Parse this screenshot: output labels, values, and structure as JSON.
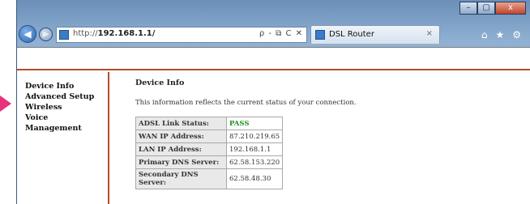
{
  "browser": {
    "url_prefix": "http://",
    "url_host": "192.168.1.1/",
    "address_tools": "ρ - ⧉ C ✕",
    "tab_title": "DSL Router",
    "tab_close": "×",
    "window_buttons": {
      "minimize": "–",
      "maximize": "▢",
      "close": "x"
    },
    "right_icons": {
      "home": "⌂",
      "favorites": "★",
      "settings": "⚙"
    }
  },
  "sidebar": {
    "items": [
      {
        "label": "Device Info"
      },
      {
        "label": "Advanced Setup"
      },
      {
        "label": "Wireless"
      },
      {
        "label": "Voice"
      },
      {
        "label": "Management"
      }
    ]
  },
  "main": {
    "title": "Device Info",
    "description": "This information reflects the current status of your connection.",
    "status_table": [
      {
        "key": "ADSL Link Status:",
        "value": "PASS"
      },
      {
        "key": "WAN IP Address:",
        "value": "87.210.219.65"
      },
      {
        "key": "LAN IP Address:",
        "value": "192.168.1.1"
      },
      {
        "key": "Primary DNS Server:",
        "value": "62.58.153.220"
      },
      {
        "key": "Secondary DNS Server:",
        "value": "62.58.48.30"
      }
    ]
  },
  "colors": {
    "accent_border": "#b84b2a",
    "pass_text": "#1e8f1e",
    "marker_arrow": "#e8317a"
  }
}
